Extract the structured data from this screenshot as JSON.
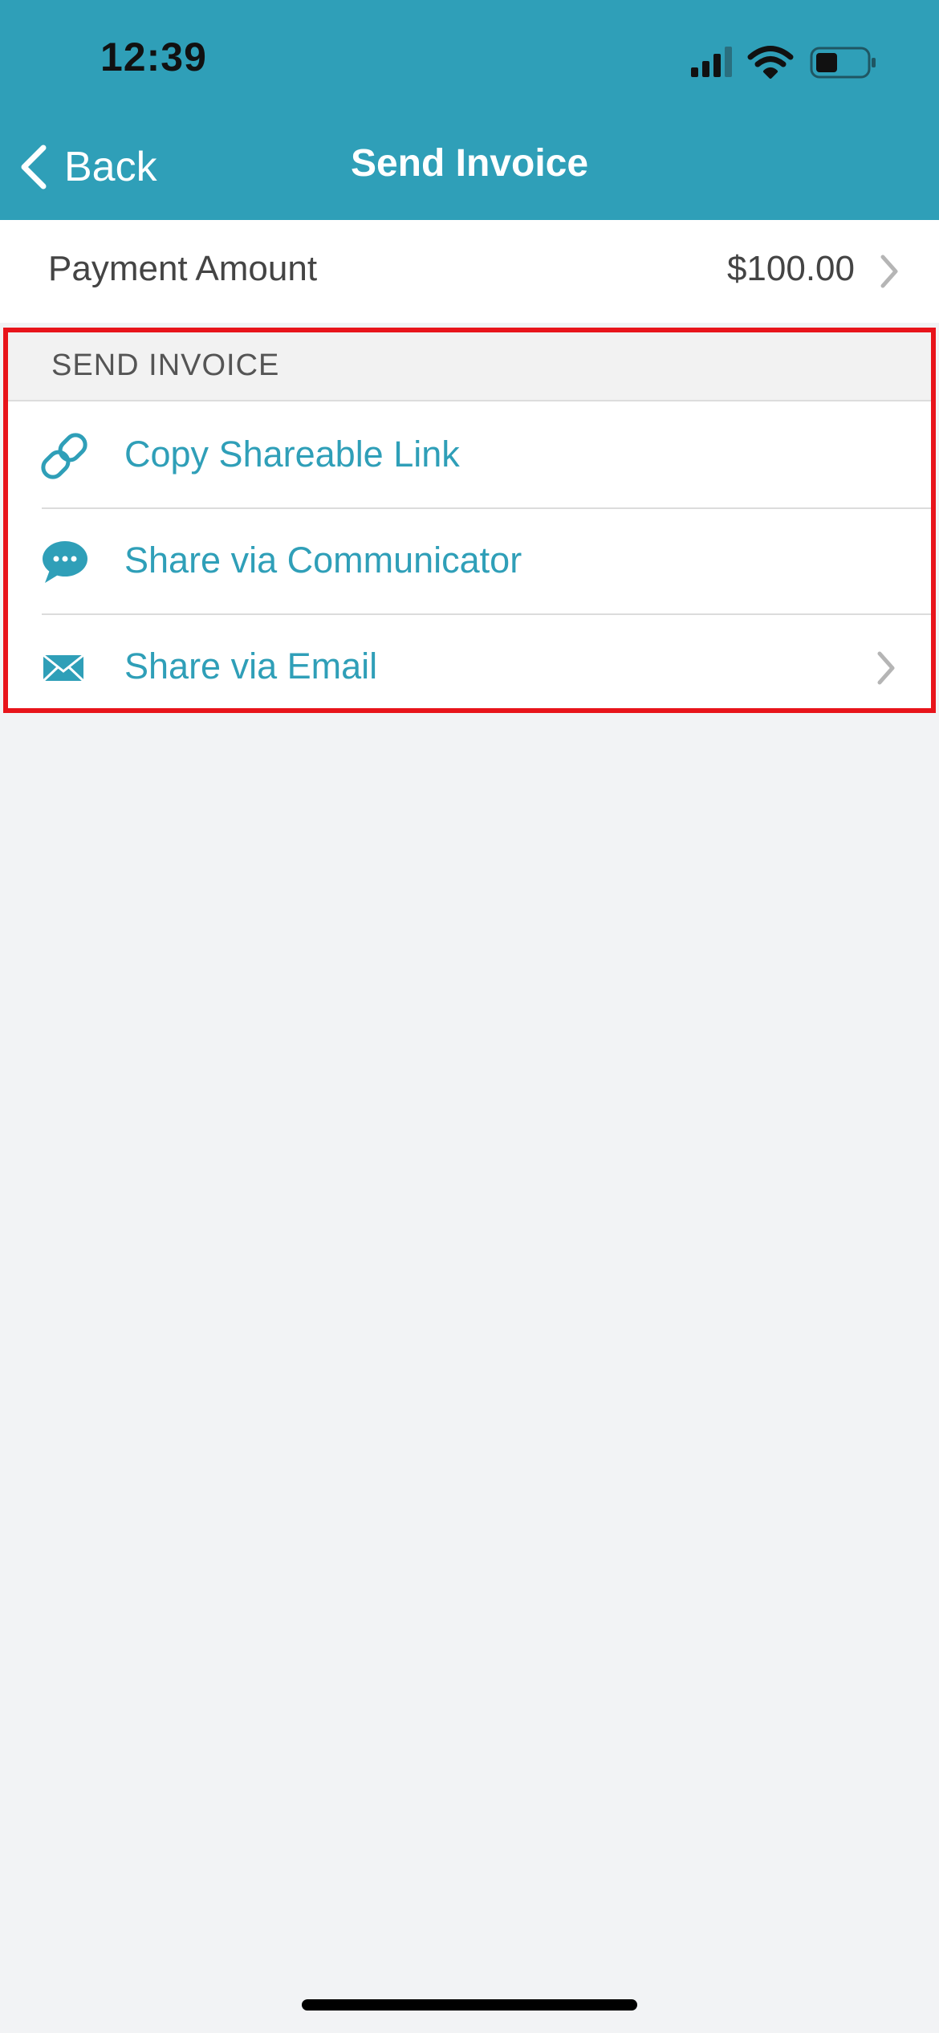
{
  "status_bar": {
    "time": "12:39",
    "icons": [
      "cellular-signal-icon",
      "wifi-icon",
      "battery-icon"
    ]
  },
  "nav": {
    "back_label": "Back",
    "title": "Send Invoice",
    "background_color": "#2f9fb8"
  },
  "payment": {
    "label": "Payment Amount",
    "value": "$100.00"
  },
  "send_section": {
    "header": "SEND INVOICE",
    "items": [
      {
        "label": "Copy Shareable Link",
        "icon": "link-icon",
        "has_chevron": false
      },
      {
        "label": "Share via Communicator",
        "icon": "chat-bubble-icon",
        "has_chevron": false
      },
      {
        "label": "Share via Email",
        "icon": "envelope-icon",
        "has_chevron": true
      }
    ],
    "highlight_color": "#e8141b"
  },
  "colors": {
    "accent": "#2f9fb8",
    "background": "#f2f3f5"
  }
}
